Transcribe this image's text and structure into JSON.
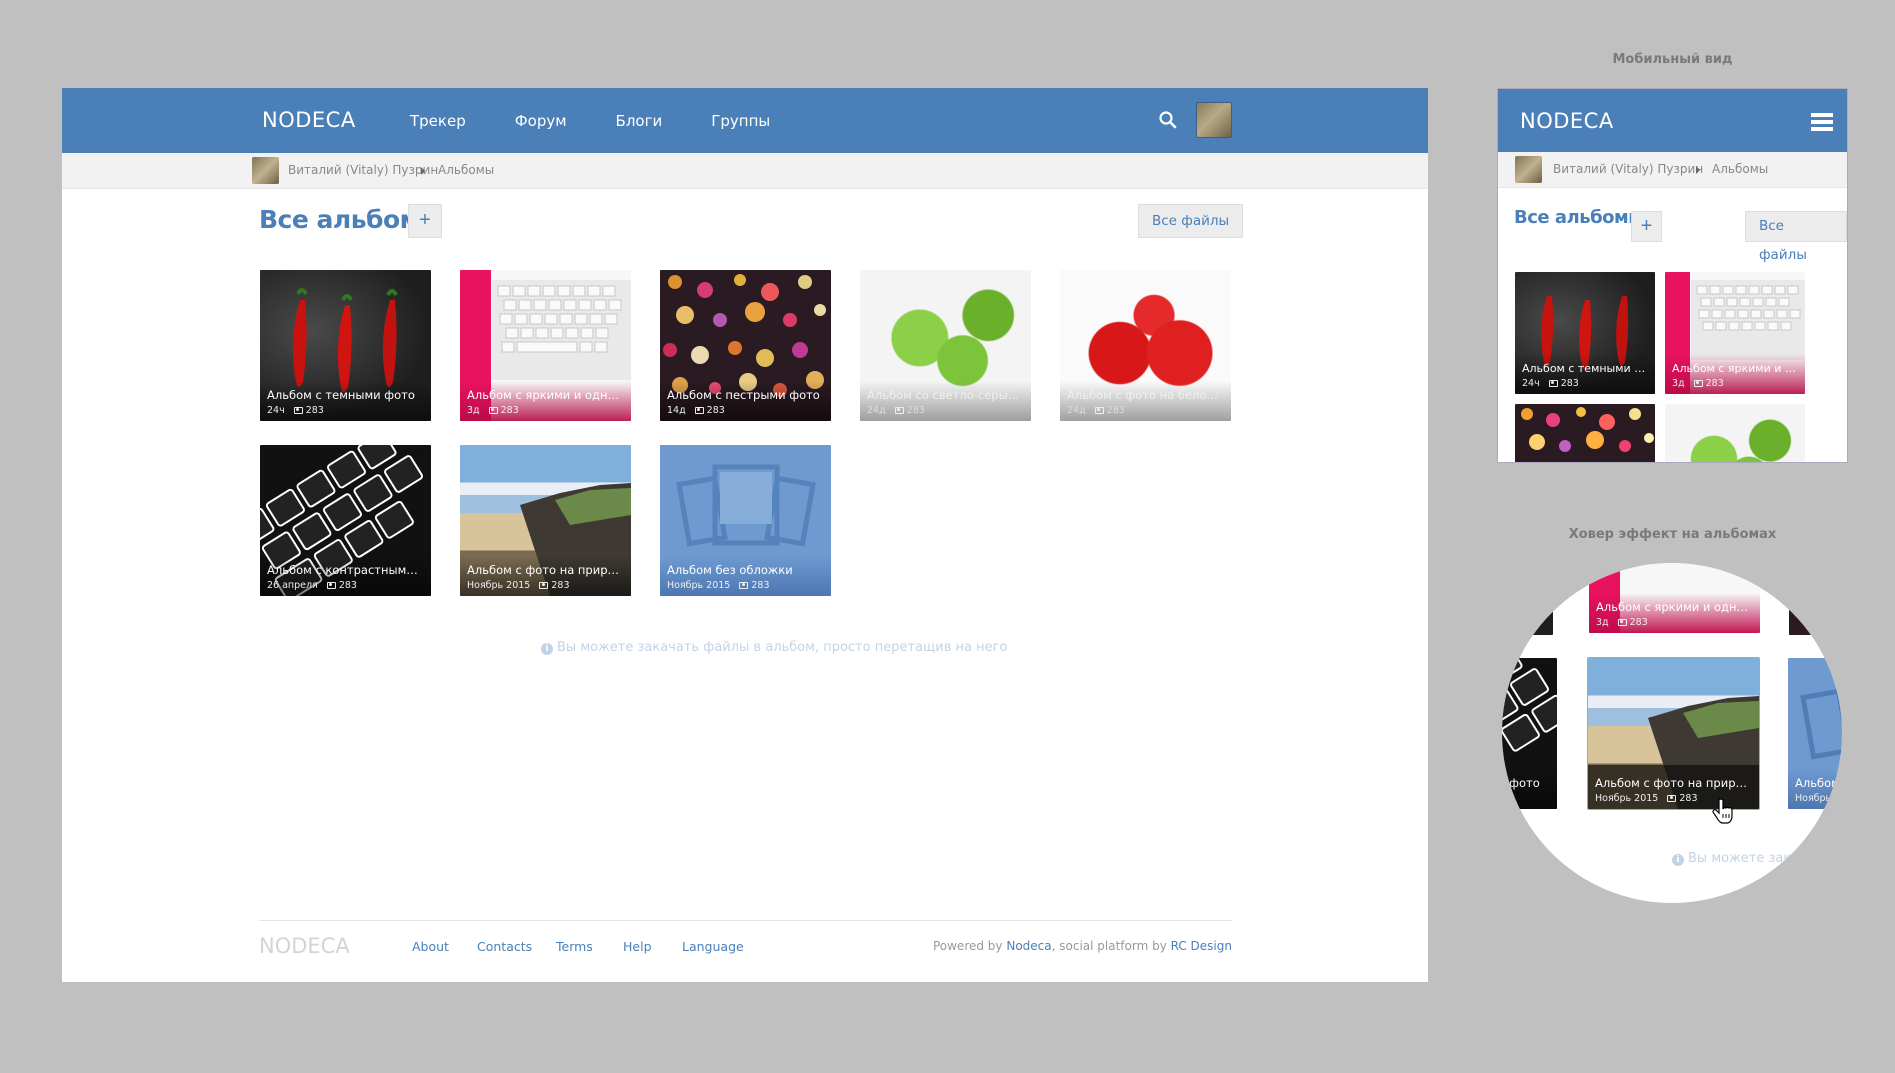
{
  "brand": "NODECA",
  "nav": [
    "Трекер",
    "Форум",
    "Блоги",
    "Группы"
  ],
  "breadcrumb": {
    "user": "Виталий (Vitaly) Пузрин",
    "section": "Альбомы"
  },
  "page": {
    "title": "Все альбомы",
    "add_label": "+",
    "all_files_label": "Все файлы"
  },
  "albums": [
    {
      "title": "Альбом с темными фото",
      "age": "24ч",
      "count": "283"
    },
    {
      "title": "Альбом с яркими и однотон...",
      "age": "3д",
      "count": "283"
    },
    {
      "title": "Альбом с пестрыми фото",
      "age": "14д",
      "count": "283"
    },
    {
      "title": "Альбом со светло-серыми ф...",
      "age": "24д",
      "count": "283"
    },
    {
      "title": "Альбом с фото на белом фо...",
      "age": "24д",
      "count": "283"
    },
    {
      "title": "Альбом с контрастными фото",
      "age": "26 апреля",
      "count": "283"
    },
    {
      "title": "Альбом с фото на природе",
      "age": "Ноябрь 2015",
      "count": "283"
    },
    {
      "title": "Альбом без обложки",
      "age": "Ноябрь 2015",
      "count": "283"
    }
  ],
  "drop_hint": "Вы можете закачать файлы в альбом, просто перетащив на него",
  "footer": {
    "logo": "NODECA",
    "links": [
      "About",
      "Contacts",
      "Terms",
      "Help",
      "Language"
    ],
    "powered_prefix": "Powered by ",
    "powered_brand": "Nodeca",
    "powered_mid": ", social platform by ",
    "powered_by": "RC Design"
  },
  "labels": {
    "mobile": "Мобильный вид",
    "hover": "Ховер эффект на альбомах"
  },
  "mobile": {
    "albums": [
      {
        "title": "Альбом с темными фото",
        "age": "24ч",
        "count": "283"
      },
      {
        "title": "Альбом с яркими и од...",
        "age": "3д",
        "count": "283"
      }
    ]
  },
  "hover": {
    "top_album": {
      "title": "Альбом с яркими и однотон...",
      "age": "3д",
      "count": "283"
    },
    "left_caption": "и фото",
    "hovered_album": {
      "title": "Альбом с фото на природе",
      "age": "Ноябрь 2015",
      "count": "283"
    },
    "right_caption": "Альбом",
    "right_meta": "Ноябрь",
    "hint": "Вы можете закач"
  },
  "colors": {
    "header": "#4a7fb8",
    "accent": "#4a7fb8",
    "hint": "#c3d3e6"
  }
}
